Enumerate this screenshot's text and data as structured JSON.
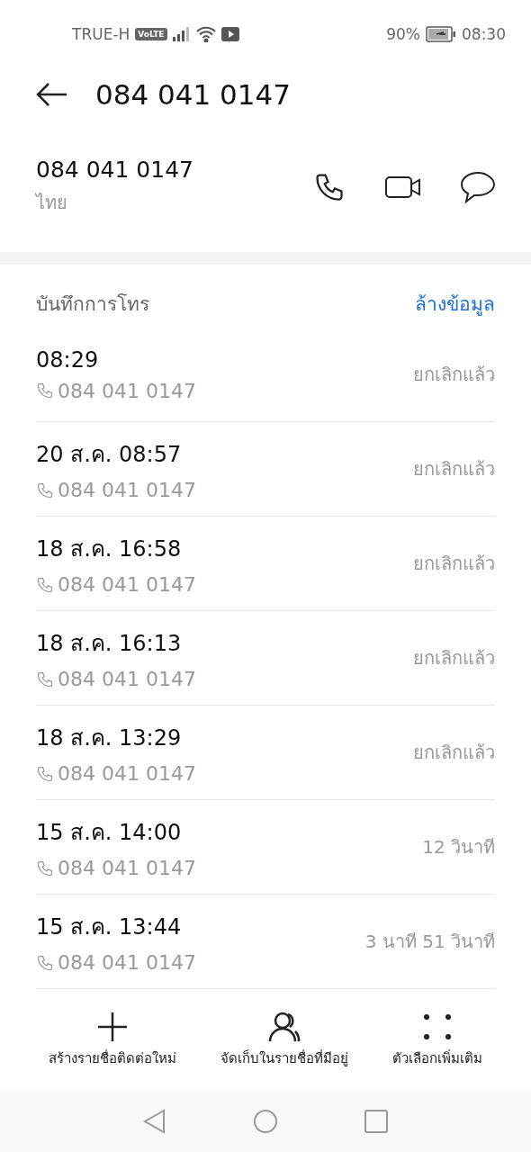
{
  "status_bar": {
    "carrier": "TRUE-H",
    "volte": "VoLTE",
    "battery_percent": "90%",
    "time": "08:30"
  },
  "header": {
    "title": "084 041 0147"
  },
  "contact": {
    "number": "084 041 0147",
    "region": "ไทย"
  },
  "call_log": {
    "title": "บันทึกการโทร",
    "clear_label": "ล้างข้อมูล",
    "entries": [
      {
        "time": "08:29",
        "number": "084 041 0147",
        "result": "ยกเลิกแล้ว"
      },
      {
        "time": "20 ส.ค. 08:57",
        "number": "084 041 0147",
        "result": "ยกเลิกแล้ว"
      },
      {
        "time": "18 ส.ค. 16:58",
        "number": "084 041 0147",
        "result": "ยกเลิกแล้ว"
      },
      {
        "time": "18 ส.ค. 16:13",
        "number": "084 041 0147",
        "result": "ยกเลิกแล้ว"
      },
      {
        "time": "18 ส.ค. 13:29",
        "number": "084 041 0147",
        "result": "ยกเลิกแล้ว"
      },
      {
        "time": "15 ส.ค. 14:00",
        "number": "084 041 0147",
        "result": "12 วินาที"
      },
      {
        "time": "15 ส.ค. 13:44",
        "number": "084 041 0147",
        "result": "3 นาที 51 วินาที"
      }
    ]
  },
  "bottom_actions": [
    {
      "kind": "add",
      "label": "สร้างรายชื่อติดต่อใหม่"
    },
    {
      "kind": "contact",
      "label": "จัดเก็บในรายชื่อที่มีอยู่"
    },
    {
      "kind": "more",
      "label": "ตัวเลือกเพิ่มเติม"
    }
  ]
}
